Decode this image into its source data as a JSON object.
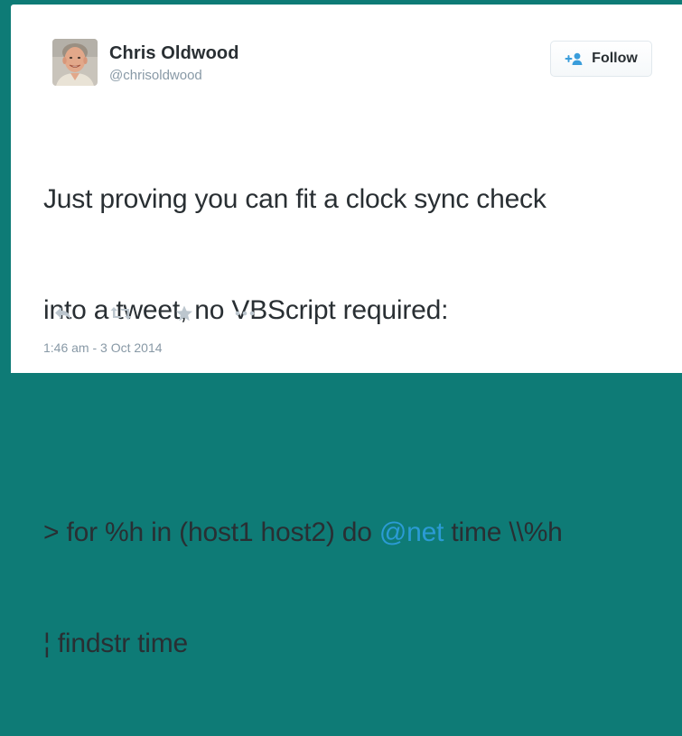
{
  "author": {
    "name": "Chris Oldwood",
    "handle": "@chrisoldwood"
  },
  "follow_button": {
    "label": "Follow"
  },
  "tweet": {
    "line1": "Just proving you can fit a clock sync check",
    "line2": "into a tweet, no VBScript required:",
    "line4_prefix": "> for %h in (host1 host2) do ",
    "line4_mention": "@net",
    "line4_suffix": " time \\\\%h",
    "line5": "¦ findstr time"
  },
  "actions": {
    "icons": [
      "reply-icon",
      "retweet-icon",
      "favorite-icon",
      "more-icon"
    ]
  },
  "timestamp": "1:46 am - 3 Oct 2014",
  "colors": {
    "frame": "#0e7b76",
    "mention": "#2b9bd5",
    "text": "#292f33",
    "muted": "#8899a6",
    "icon": "#bcc6ce"
  }
}
